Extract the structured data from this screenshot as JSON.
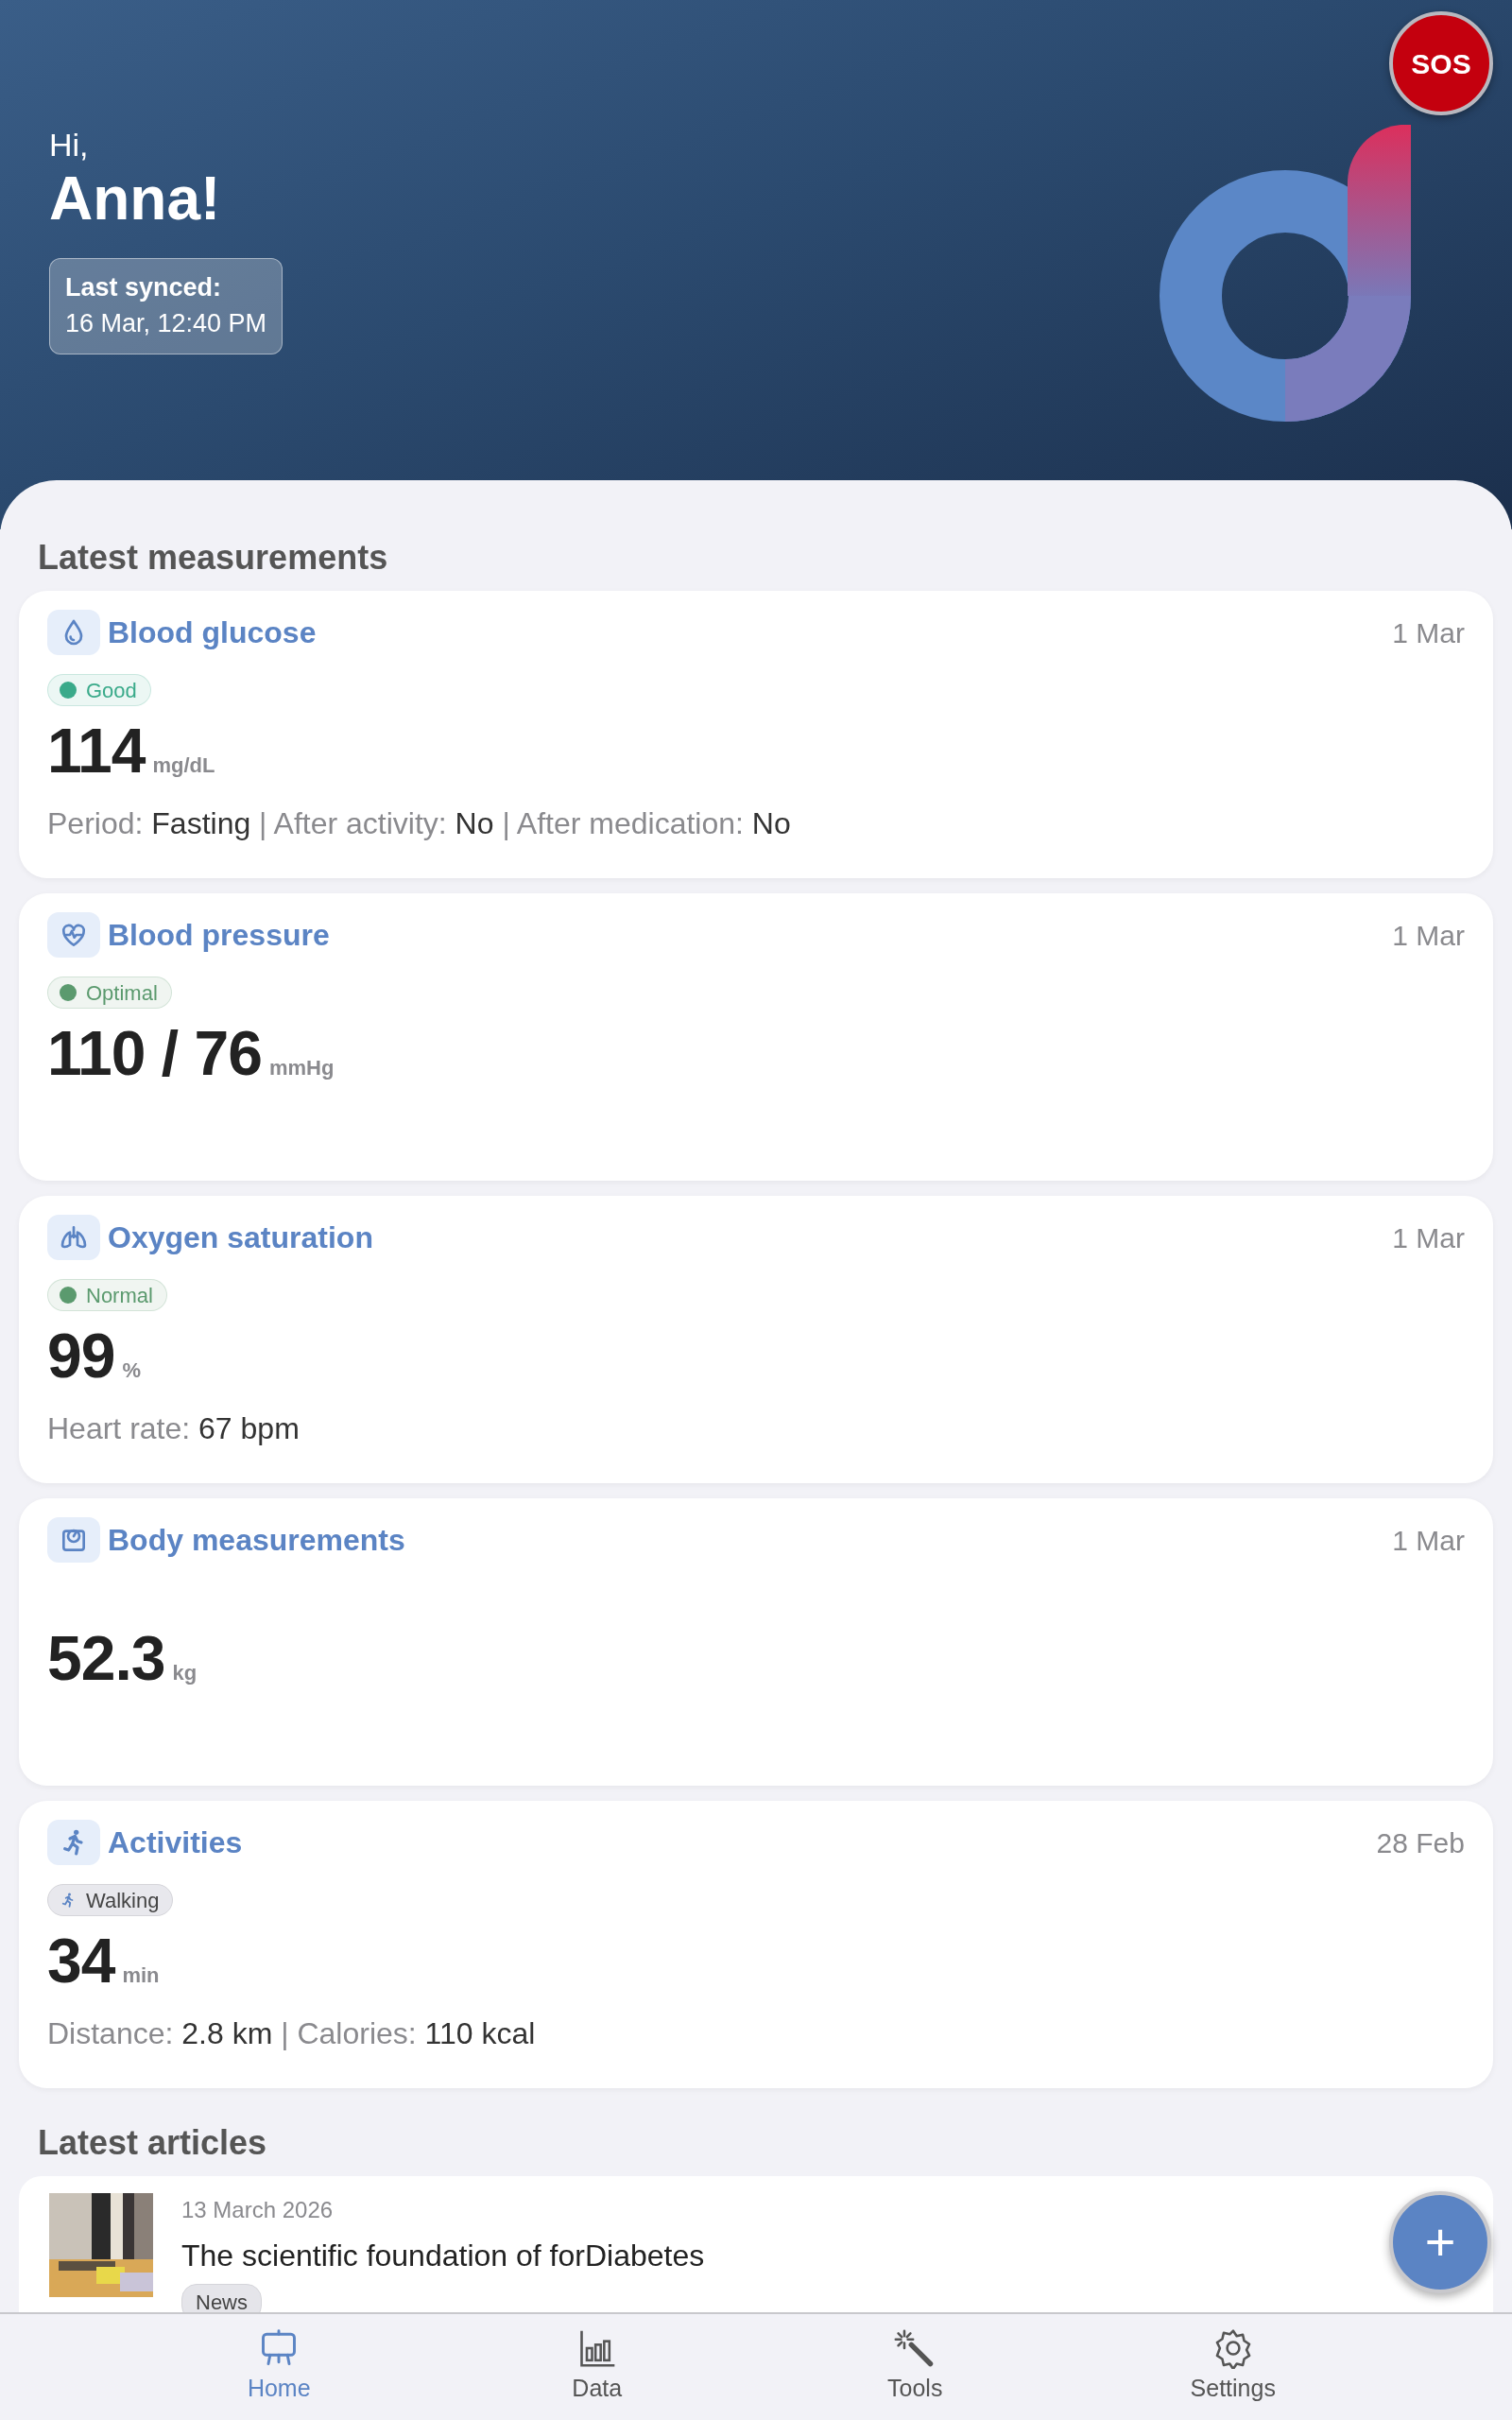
{
  "header": {
    "greeting": "Hi,",
    "name": "Anna!",
    "sync_label": "Last synced:",
    "sync_time": "16 Mar, 12:40 PM",
    "sos": "SOS"
  },
  "measurements_title": "Latest measurements",
  "measurements": [
    {
      "kind": "glucose",
      "title": "Blood glucose",
      "date": "1 Mar",
      "badge": {
        "kind": "status",
        "label": "Good",
        "color": "#3aaa8a"
      },
      "value": "114",
      "unit": "mg/dL",
      "details": [
        {
          "label": "Period:",
          "value": "Fasting"
        },
        {
          "label": "| After activity:",
          "value": "No"
        },
        {
          "label": "| After medication:",
          "value": "No"
        }
      ]
    },
    {
      "kind": "pressure",
      "title": "Blood pressure",
      "date": "1 Mar",
      "badge": {
        "kind": "status",
        "label": "Optimal",
        "color": "#5b9a6e"
      },
      "value": "110 / 76",
      "unit": "mmHg"
    },
    {
      "kind": "oxygen",
      "title": "Oxygen saturation",
      "date": "1 Mar",
      "badge": {
        "kind": "status",
        "label": "Normal",
        "color": "#5b9a6e"
      },
      "value": "99",
      "unit": "%",
      "details": [
        {
          "label": "Heart rate:",
          "value": "67 bpm"
        }
      ]
    },
    {
      "kind": "body",
      "title": "Body measurements",
      "date": "1 Mar",
      "value": "52.3",
      "unit": "kg"
    },
    {
      "kind": "activity",
      "title": "Activities",
      "date": "28 Feb",
      "badge": {
        "kind": "activity",
        "label": "Walking"
      },
      "value": "34",
      "unit": "min",
      "details": [
        {
          "label": "Distance:",
          "value": "2.8 km"
        },
        {
          "label": "| Calories:",
          "value": "110 kcal"
        }
      ]
    }
  ],
  "articles_title": "Latest articles",
  "articles": [
    {
      "kind": "picture",
      "date": "13 March 2026",
      "title": "The scientific foundation of forDiabetes",
      "tag": "News"
    }
  ],
  "fab": "+",
  "nav": [
    {
      "kind": "home",
      "label": "Home",
      "selected": true
    },
    {
      "kind": "data",
      "label": "Data",
      "selected": false
    },
    {
      "kind": "tools",
      "label": "Tools",
      "selected": false
    },
    {
      "kind": "settings",
      "label": "Settings",
      "selected": false
    }
  ]
}
